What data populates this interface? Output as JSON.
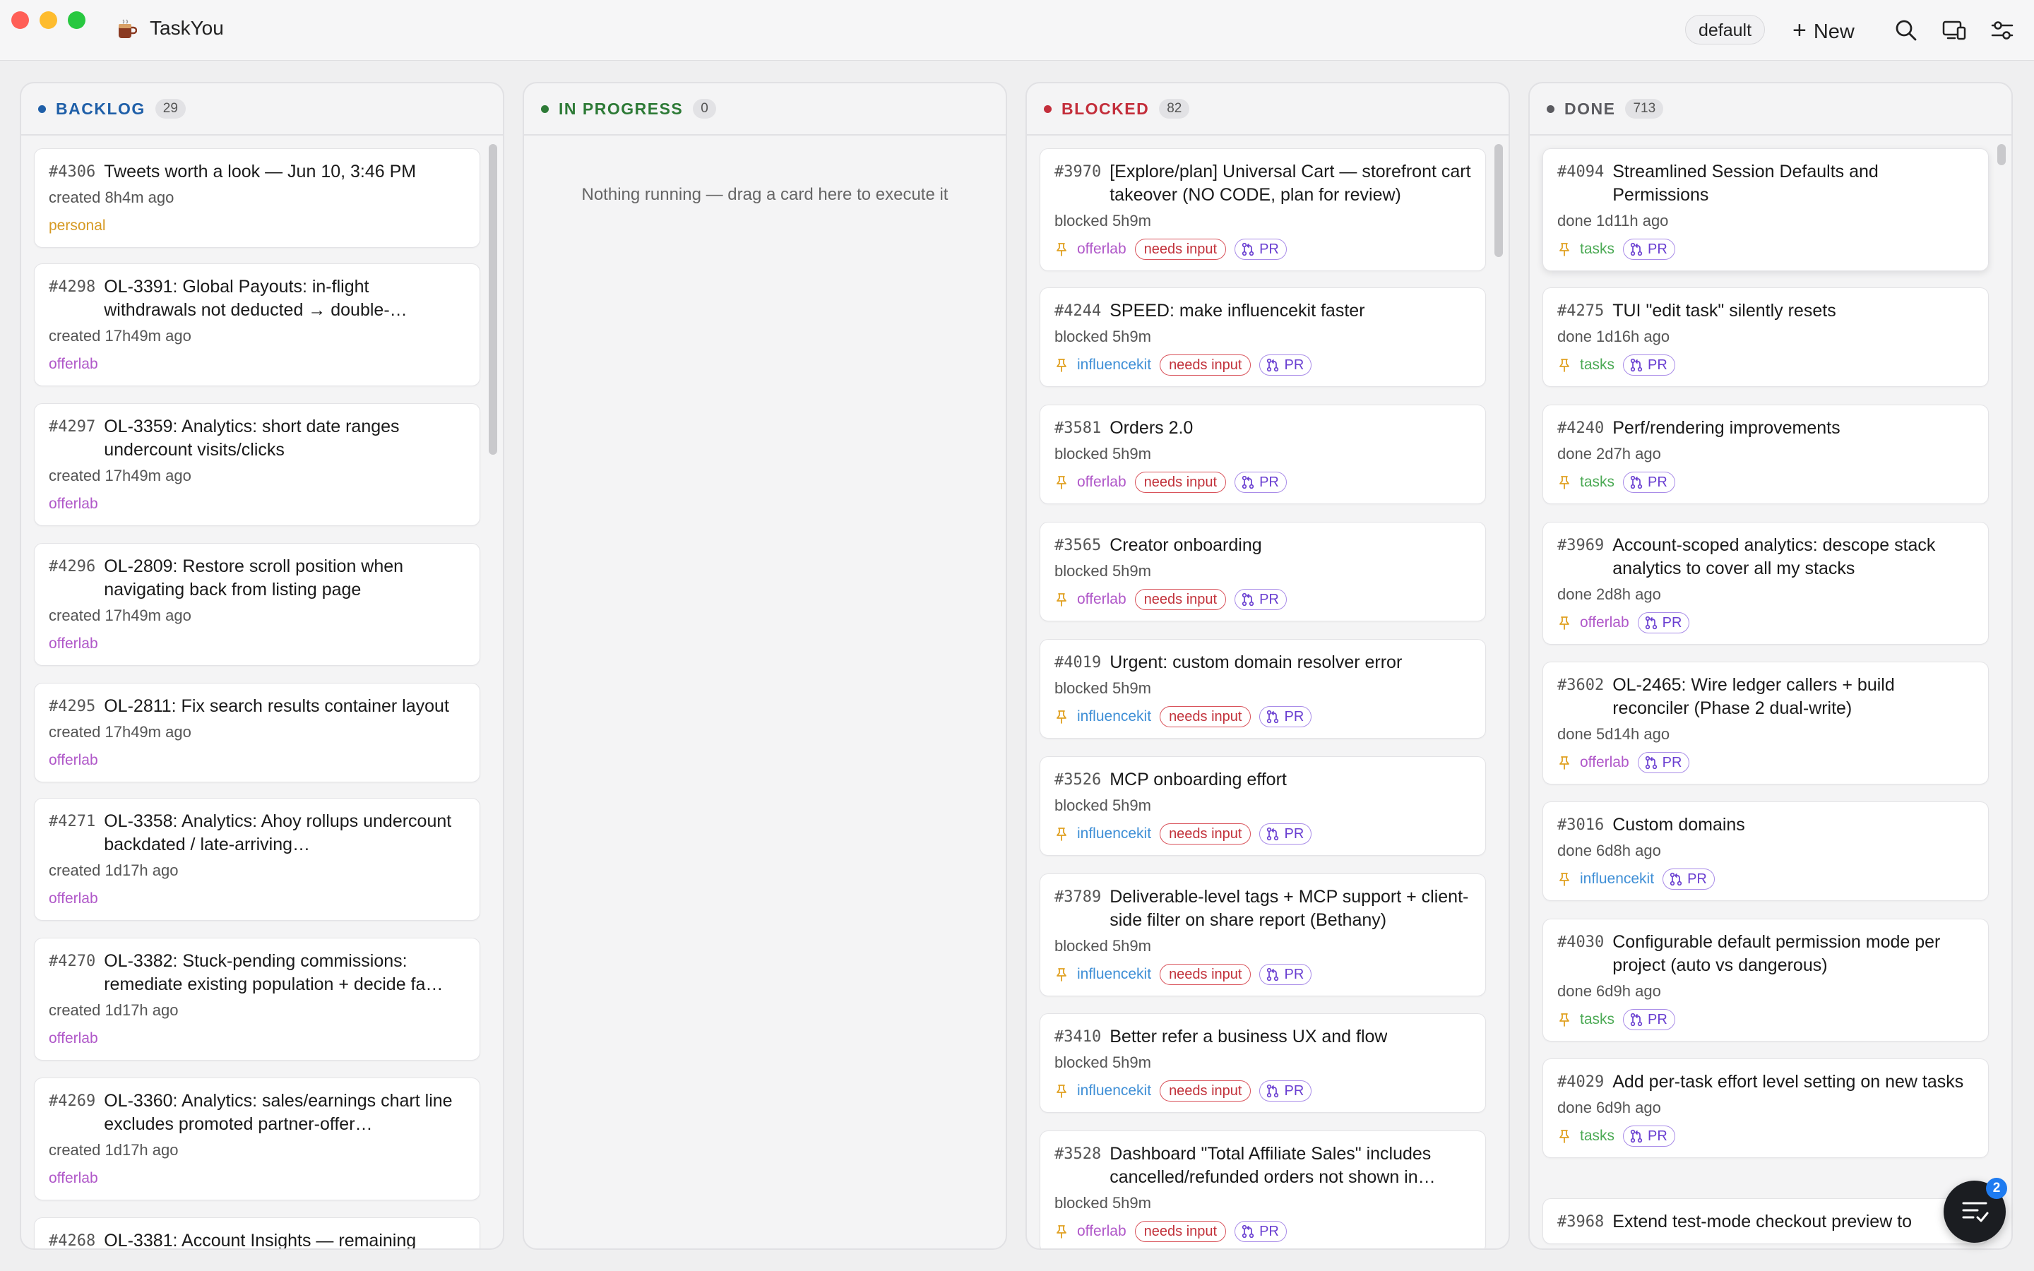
{
  "app": {
    "title": "TaskYou"
  },
  "toolbar": {
    "project": "default",
    "new_label": "New"
  },
  "colors": {
    "backlog": "#1f5fa8",
    "in_progress": "#2d7a36",
    "blocked": "#c32e3b",
    "done": "#5b5b60",
    "project_personal": "#d69a24",
    "project_offerlab": "#b058c9",
    "project_influencekit": "#3f8fd6",
    "project_tasks": "#4caa55"
  },
  "columns": [
    {
      "key": "backlog",
      "title": "BACKLOG",
      "count": "29",
      "empty": "",
      "cards": [
        {
          "id": "#4306",
          "title": "Tweets worth a look — Jun 10, 3:46 PM",
          "meta": "created 8h4m ago",
          "project": "personal"
        },
        {
          "id": "#4298",
          "title": "OL-3391: Global Payouts: in-flight withdrawals not deducted → double-…",
          "meta": "created 17h49m ago",
          "project": "offerlab"
        },
        {
          "id": "#4297",
          "title": "OL-3359: Analytics: short date ranges undercount visits/clicks",
          "meta": "created 17h49m ago",
          "project": "offerlab"
        },
        {
          "id": "#4296",
          "title": "OL-2809: Restore scroll position when navigating back from listing page",
          "meta": "created 17h49m ago",
          "project": "offerlab"
        },
        {
          "id": "#4295",
          "title": "OL-2811: Fix search results container layout",
          "meta": "created 17h49m ago",
          "project": "offerlab"
        },
        {
          "id": "#4271",
          "title": "OL-3358: Analytics: Ahoy rollups undercount backdated / late-arriving…",
          "meta": "created 1d17h ago",
          "project": "offerlab"
        },
        {
          "id": "#4270",
          "title": "OL-3382: Stuck-pending commissions: remediate existing population + decide fa…",
          "meta": "created 1d17h ago",
          "project": "offerlab"
        },
        {
          "id": "#4269",
          "title": "OL-3360: Analytics: sales/earnings chart line excludes promoted partner-offer…",
          "meta": "created 1d17h ago",
          "project": "offerlab"
        },
        {
          "id": "#4268",
          "title": "OL-3381: Account Insights — remaining",
          "meta": "",
          "project": ""
        }
      ]
    },
    {
      "key": "in_progress",
      "title": "IN PROGRESS",
      "count": "0",
      "empty": "Nothing running — drag a card here to execute it",
      "cards": []
    },
    {
      "key": "blocked",
      "title": "BLOCKED",
      "count": "82",
      "empty": "",
      "cards": [
        {
          "id": "#3970",
          "title": "[Explore/plan] Universal Cart — storefront cart takeover (NO CODE, plan for review)",
          "meta": "blocked 5h9m",
          "project": "offerlab",
          "needs": "needs input",
          "pr": "PR"
        },
        {
          "id": "#4244",
          "title": "SPEED: make influencekit faster",
          "meta": "blocked 5h9m",
          "project": "influencekit",
          "needs": "needs input",
          "pr": "PR"
        },
        {
          "id": "#3581",
          "title": "Orders 2.0",
          "meta": "blocked 5h9m",
          "project": "offerlab",
          "needs": "needs input",
          "pr": "PR"
        },
        {
          "id": "#3565",
          "title": "Creator onboarding",
          "meta": "blocked 5h9m",
          "project": "offerlab",
          "needs": "needs input",
          "pr": "PR"
        },
        {
          "id": "#4019",
          "title": "Urgent: custom domain resolver error",
          "meta": "blocked 5h9m",
          "project": "influencekit",
          "needs": "needs input",
          "pr": "PR"
        },
        {
          "id": "#3526",
          "title": "MCP onboarding effort",
          "meta": "blocked 5h9m",
          "project": "influencekit",
          "needs": "needs input",
          "pr": "PR"
        },
        {
          "id": "#3789",
          "title": "Deliverable-level tags + MCP support + client-side filter on share report (Bethany)",
          "meta": "blocked 5h9m",
          "project": "influencekit",
          "needs": "needs input",
          "pr": "PR"
        },
        {
          "id": "#3410",
          "title": "Better refer a business UX and flow",
          "meta": "blocked 5h9m",
          "project": "influencekit",
          "needs": "needs input",
          "pr": "PR"
        },
        {
          "id": "#3528",
          "title": "Dashboard \"Total Affiliate Sales\" includes cancelled/refunded orders not shown in…",
          "meta": "blocked 5h9m",
          "project": "offerlab",
          "needs": "needs input",
          "pr": "PR"
        }
      ]
    },
    {
      "key": "done",
      "title": "DONE",
      "count": "713",
      "empty": "",
      "cards": [
        {
          "id": "#4094",
          "title": "Streamlined Session Defaults and Permissions",
          "meta": "done 1d11h ago",
          "project": "tasks",
          "pr": "PR"
        },
        {
          "id": "#4275",
          "title": "TUI \"edit task\" silently resets",
          "meta": "done 1d16h ago",
          "project": "tasks",
          "pr": "PR"
        },
        {
          "id": "#4240",
          "title": "Perf/rendering improvements",
          "meta": "done 2d7h ago",
          "project": "tasks",
          "pr": "PR"
        },
        {
          "id": "#3969",
          "title": "Account-scoped analytics: descope stack analytics to cover all my stacks",
          "meta": "done 2d8h ago",
          "project": "offerlab",
          "pr": "PR"
        },
        {
          "id": "#3602",
          "title": "OL-2465: Wire ledger callers + build reconciler (Phase 2 dual-write)",
          "meta": "done 5d14h ago",
          "project": "offerlab",
          "pr": "PR"
        },
        {
          "id": "#3016",
          "title": "Custom domains",
          "meta": "done 6d8h ago",
          "project": "influencekit",
          "pr": "PR"
        },
        {
          "id": "#4030",
          "title": "Configurable default permission mode per project (auto vs dangerous)",
          "meta": "done 6d9h ago",
          "project": "tasks",
          "pr": "PR"
        },
        {
          "id": "#4029",
          "title": "Add per-task effort level setting on new tasks",
          "meta": "done 6d9h ago",
          "project": "tasks",
          "pr": "PR"
        },
        {
          "id": "#3968",
          "title": "Extend test-mode checkout preview to",
          "meta": "",
          "project": ""
        }
      ]
    }
  ],
  "fab": {
    "badge": "2"
  },
  "icons": [
    "close-window-icon",
    "minimize-window-icon",
    "zoom-window-icon",
    "coffee-app-icon",
    "plus-icon",
    "search-icon",
    "devices-icon",
    "settings-sliders-icon",
    "pin-icon",
    "pull-request-icon",
    "task-list-icon"
  ]
}
